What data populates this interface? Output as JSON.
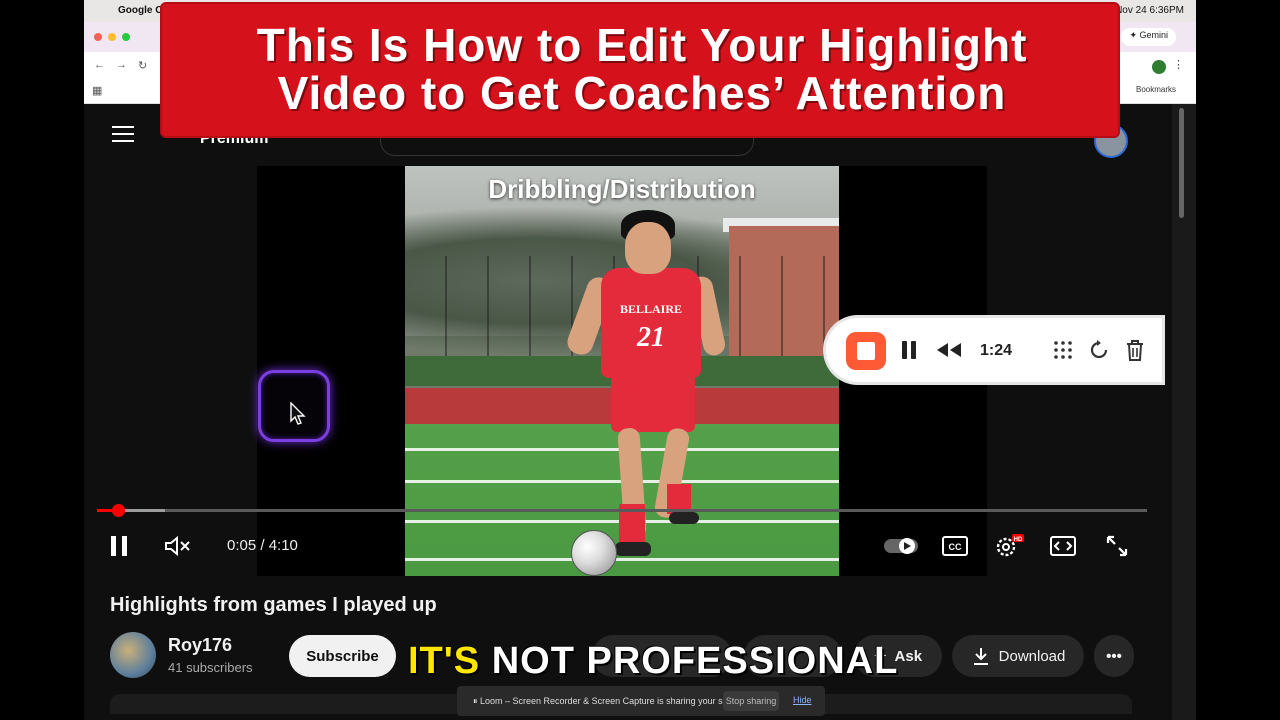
{
  "menubar": {
    "app_name": "Google Ch",
    "clock": "Nov 24  6:36PM"
  },
  "browser": {
    "gemini_label": "Gemini",
    "bookmarks_label": "Bookmarks"
  },
  "youtube": {
    "logo_text": "Premium"
  },
  "banner": {
    "line1": "This Is How to Edit Your Highlight",
    "line2": "Video to Get Coaches’ Attention"
  },
  "video": {
    "overlay_title": "Dribbling/Distribution",
    "jersey_text": "BELLAIRE",
    "jersey_number": "21",
    "time_display": "0:05 / 4:10",
    "progress_fraction": 0.02,
    "title": "Highlights from games I played up"
  },
  "loom_recorder": {
    "elapsed": "1:24"
  },
  "channel": {
    "name": "Roy176",
    "subscribers": "41 subscribers",
    "subscribe_label": "Subscribe"
  },
  "actions": {
    "ask_label": "Ask",
    "download_label": "Download"
  },
  "caption": {
    "highlight": "IT'S",
    "rest": "NOT PROFESSIONAL"
  },
  "screen_share": {
    "message": "Loom – Screen Recorder & Screen Capture is sharing your screen.",
    "stop_label": "Stop sharing",
    "hide_label": "Hide"
  },
  "colors": {
    "banner_red": "#d5121c",
    "yt_red": "#ff0000",
    "loom_orange": "#ff5a36",
    "caption_yellow": "#ffe600"
  }
}
